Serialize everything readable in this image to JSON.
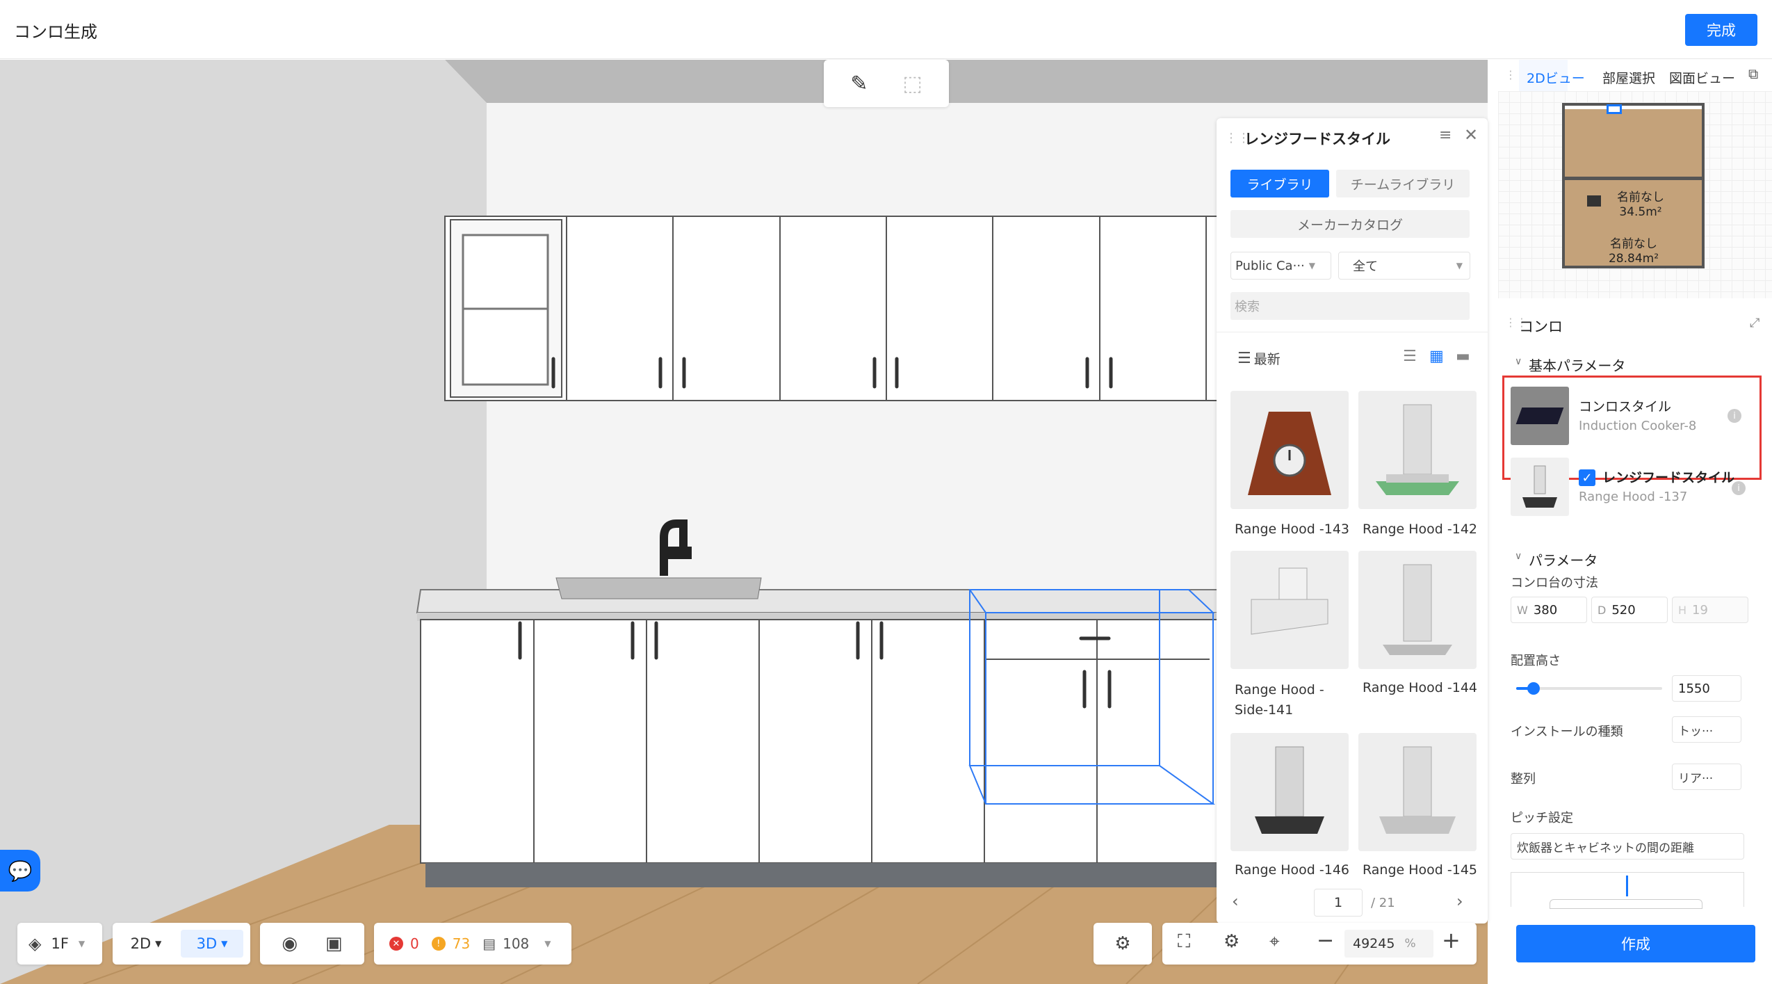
{
  "app": {
    "title": "コンロ生成",
    "done_label": "完成"
  },
  "toolbar_top": {
    "paint_icon": "paint-icon",
    "frame_icon": "frame-icon"
  },
  "library": {
    "title": "レンジフードスタイル",
    "tab_library": "ライブラリ",
    "tab_team": "チームライブラリ",
    "maker_catalog": "メーカーカタログ",
    "filter_source": "Public Ca···",
    "filter_all": "全て",
    "search_placeholder": "検索",
    "sort_label": "最新",
    "items": [
      {
        "label": "Range Hood -143",
        "icon": "clock-hood"
      },
      {
        "label": "Range Hood -142",
        "icon": "hood"
      },
      {
        "label": "Range Hood - Side-141",
        "icon": "side-hood"
      },
      {
        "label": "Range Hood -144",
        "icon": "hood"
      },
      {
        "label": "Range Hood -146",
        "icon": "hood-dark"
      },
      {
        "label": "Range Hood -145",
        "icon": "hood"
      }
    ],
    "page_current": "1",
    "page_total": "/ 21"
  },
  "view_tabs": {
    "tab_2d": "2Dビュー",
    "tab_room": "部屋選択",
    "tab_plan": "図面ビュー"
  },
  "floorplan": {
    "rooms": [
      {
        "name": "名前なし",
        "area": "34.5m²"
      },
      {
        "name": "名前なし",
        "area": "28.84m²"
      }
    ]
  },
  "props": {
    "title": "コンロ",
    "section_basic": "基本パラメータ",
    "stove_style_label": "コンロスタイル",
    "stove_style_value": "Induction Cooker-8",
    "hood_style_label": "レンジフードスタイル",
    "hood_style_value": "Range Hood -137",
    "section_params": "パラメータ",
    "size_label": "コンロ台の寸法",
    "w_label": "W",
    "w_value": "380",
    "d_label": "D",
    "d_value": "520",
    "h_label": "H",
    "h_value": "19",
    "height_label": "配置高さ",
    "height_value": "1550",
    "install_label": "インストールの種類",
    "install_value": "トッ···",
    "align_label": "整列",
    "align_value": "リア···",
    "pitch_label": "ピッチ設定",
    "pitch_value": "炊飯器とキャビネットの間の距離",
    "create_label": "作成"
  },
  "bottom": {
    "floor": "1F",
    "view2d": "2D",
    "view3d": "3D",
    "errors": "0",
    "warnings": "73",
    "items": "108",
    "zoom": "49245",
    "zoom_unit": "%"
  },
  "colors": {
    "accent": "#1677ff",
    "highlight": "#e53935"
  }
}
